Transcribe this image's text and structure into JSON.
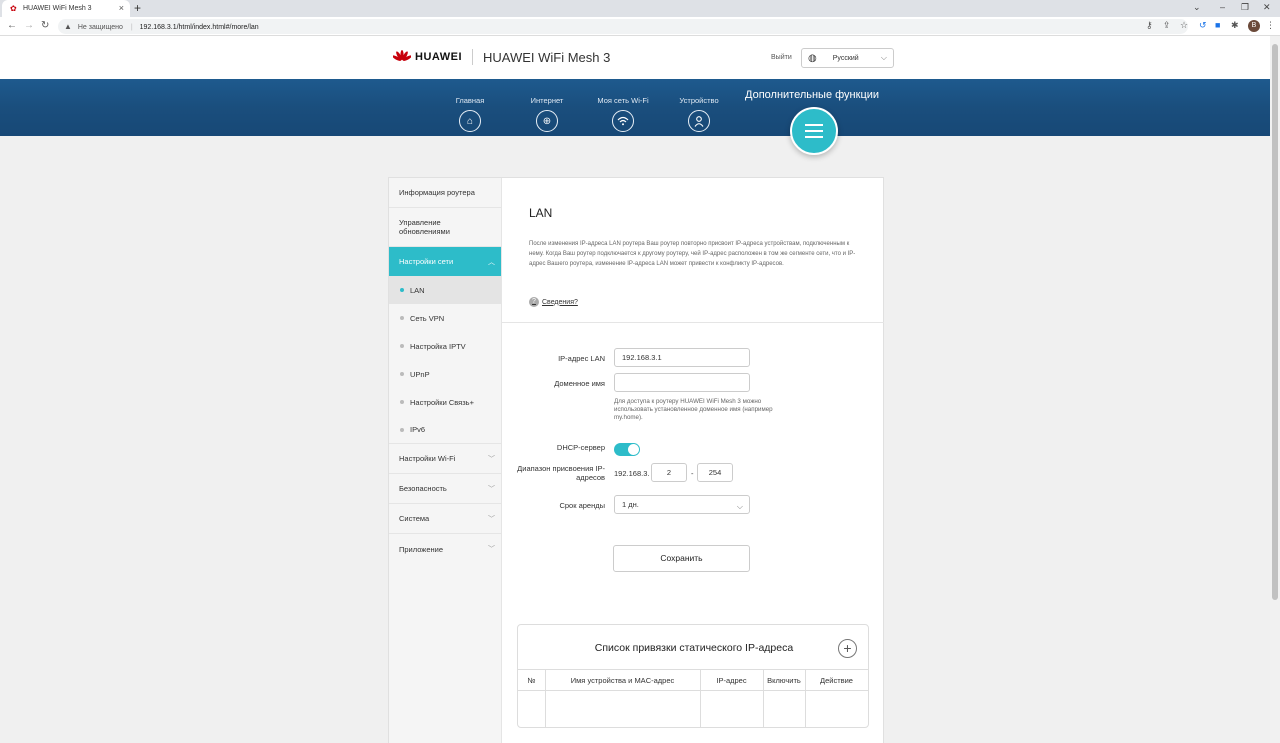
{
  "browser": {
    "tab_title": "HUAWEI WiFi Mesh 3",
    "insecure_label": "Не защищено",
    "url": "192.168.3.1/html/index.html#/more/lan",
    "profile_initial": "B"
  },
  "header": {
    "brand": "HUAWEI",
    "product": "HUAWEI WiFi Mesh 3",
    "logout": "Выйти",
    "language": "Русский",
    "brand_color": "#c7000b"
  },
  "nav": {
    "items": [
      {
        "label": "Главная",
        "icon": "home-icon"
      },
      {
        "label": "Интернет",
        "icon": "globe-icon"
      },
      {
        "label": "Моя сеть Wi-Fi",
        "icon": "wifi-icon"
      },
      {
        "label": "Устройство",
        "icon": "user-icon"
      }
    ],
    "advanced": "Дополнительные функции",
    "accent": "#2dbcc9"
  },
  "sidebar": {
    "router_info": "Информация роутера",
    "update_mgmt": "Управление обновлениями",
    "network_settings": "Настройки сети",
    "sub_items": [
      "LAN",
      "Сеть VPN",
      "Настройка IPTV",
      "UPnP",
      "Настройки Связь+",
      "IPv6"
    ],
    "wifi_settings": "Настройки Wi-Fi",
    "security": "Безопасность",
    "system": "Система",
    "apps": "Приложение"
  },
  "lan": {
    "title": "LAN",
    "description": "После изменения IP-адреса LAN роутера Ваш роутер повторно присвоит IP-адреса устройствам, подключенным к нему. Когда Ваш роутер подключается к другому роутеру, чей IP-адрес расположен в том же сегменте сети, что и IP-адрес Вашего роутера, изменение IP-адреса LAN может привести к конфликту IP-адресов.",
    "info_link": "Сведения?",
    "ip_label": "IP-адрес LAN",
    "ip_value": "192.168.3.1",
    "domain_label": "Доменное имя",
    "domain_value": "",
    "domain_hint": "Для доступа к роутеру HUAWEI WiFi Mesh 3 можно использовать установленное доменное имя (например my.home).",
    "dhcp_label": "DHCP-сервер",
    "dhcp_enabled": true,
    "range_label": "Диапазон присвоения IP-адресов",
    "range_prefix": "192.168.3.",
    "range_start": "2",
    "range_dash": "-",
    "range_end": "254",
    "lease_label": "Срок аренды",
    "lease_value": "1 дн.",
    "save": "Сохранить"
  },
  "static_table": {
    "title": "Список привязки статического IP-адреса",
    "add": "+",
    "columns": [
      "№",
      "Имя устройства и MAC-адрес",
      "IP-адрес",
      "Включить",
      "Действие"
    ]
  }
}
